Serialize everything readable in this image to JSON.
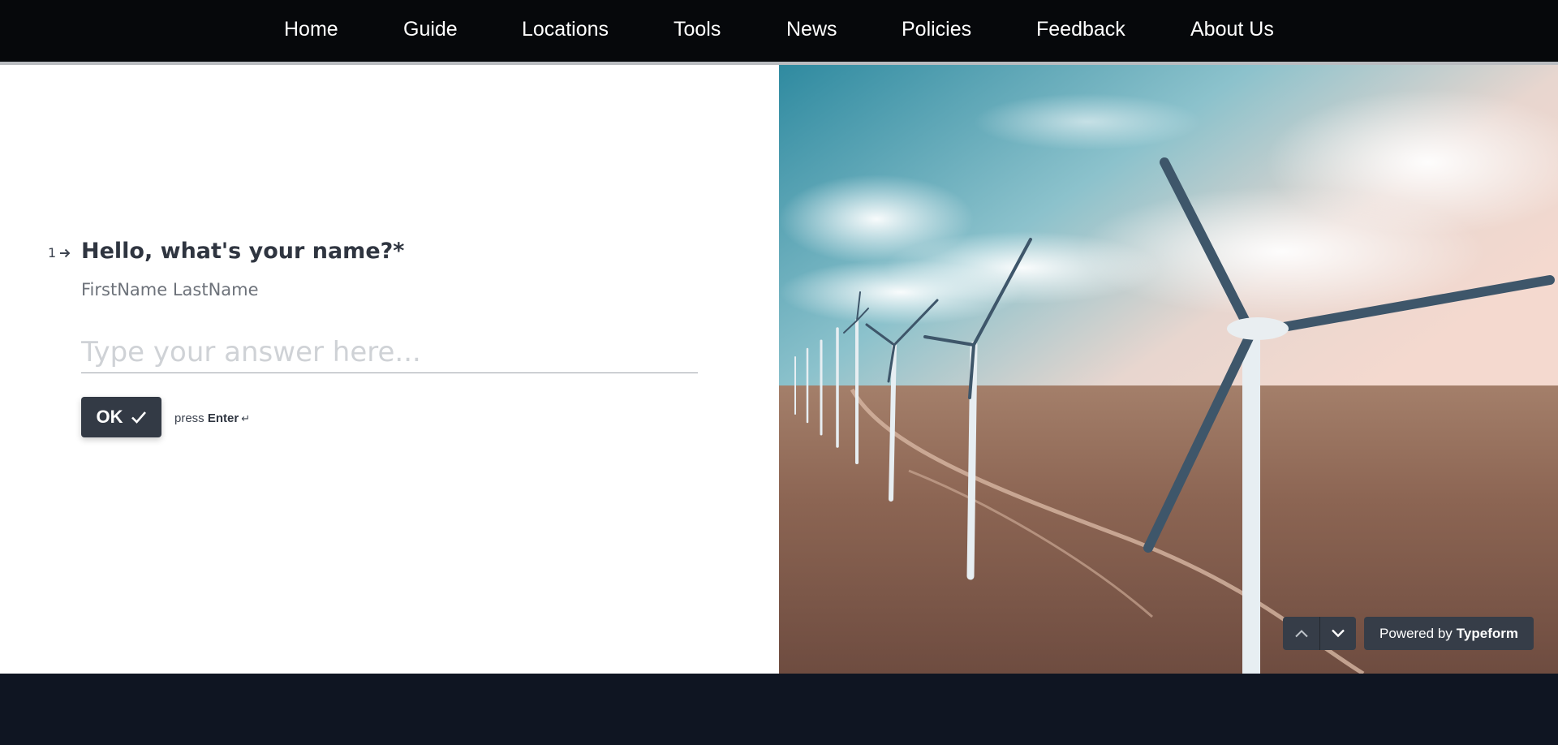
{
  "nav": {
    "items": [
      {
        "label": "Home"
      },
      {
        "label": "Guide"
      },
      {
        "label": "Locations"
      },
      {
        "label": "Tools"
      },
      {
        "label": "News"
      },
      {
        "label": "Policies"
      },
      {
        "label": "Feedback"
      },
      {
        "label": "About Us"
      }
    ]
  },
  "form": {
    "question_number": "1",
    "question_title": "Hello, what's your name?*",
    "question_description": "FirstName LastName",
    "answer_placeholder": "Type your answer here...",
    "answer_value": "",
    "ok_label": "OK",
    "press_label": "press",
    "enter_label": "Enter",
    "enter_glyph": "↵"
  },
  "badge": {
    "powered_prefix": "Powered by",
    "powered_brand": "Typeform"
  },
  "icons": {
    "question_arrow": "arrow-right-icon",
    "ok_check": "check-icon",
    "prev": "chevron-up-icon",
    "next": "chevron-down-icon"
  },
  "colors": {
    "nav_bg": "#06080b",
    "button_bg": "#333a45",
    "footer_bg": "#0f1522",
    "text_dark": "#2f3540"
  }
}
